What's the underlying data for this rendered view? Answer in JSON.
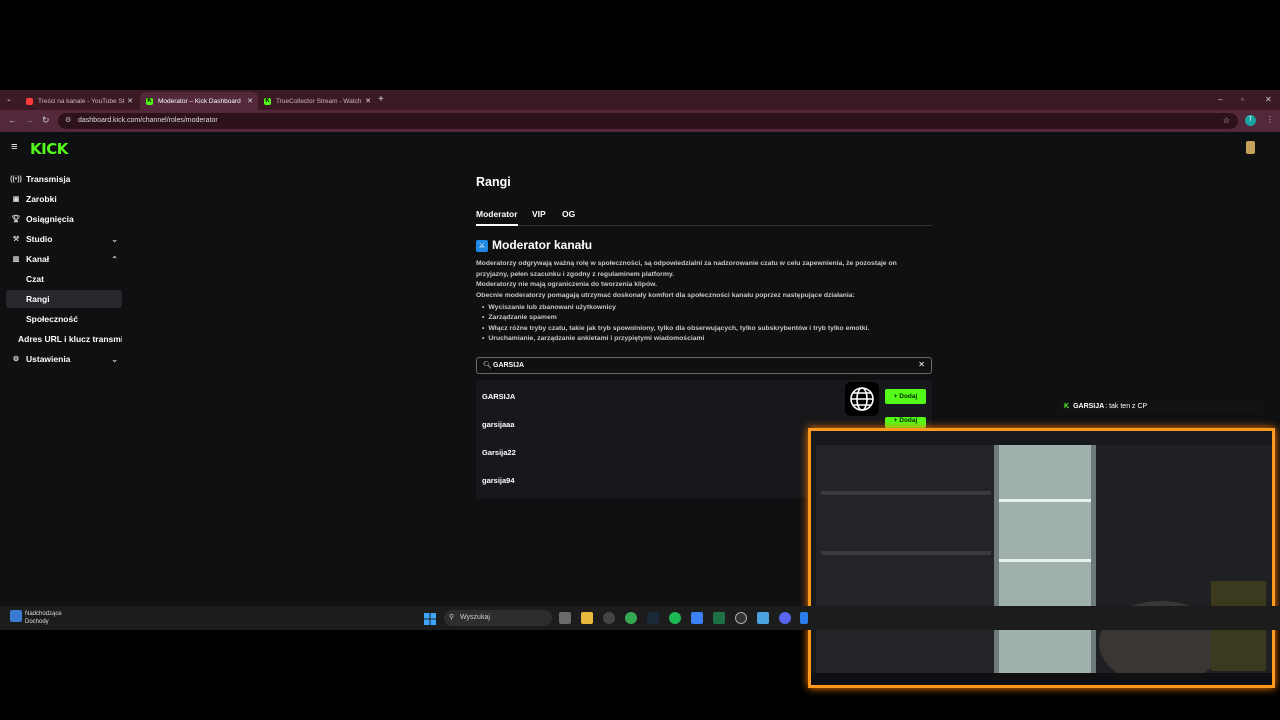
{
  "browser": {
    "tabs": [
      {
        "label": "Treści na kanale - YouTube Studio",
        "active": false,
        "favicon_color": "#ff3b3b"
      },
      {
        "label": "Moderator – Kick Dashboard",
        "active": true,
        "favicon_color": "#53fc18"
      },
      {
        "label": "TrueCollector Stream - Watch Live",
        "active": false,
        "favicon_color": "#53fc18"
      }
    ],
    "url": "dashboard.kick.com/channel/roles/moderator",
    "profile_initial": "T"
  },
  "app": {
    "logo": "KICK",
    "sidebar": {
      "items": [
        {
          "label": "Transmisja",
          "icon": "broadcast-icon"
        },
        {
          "label": "Zarobki",
          "icon": "earnings-icon"
        },
        {
          "label": "Osiągnięcia",
          "icon": "trophy-icon"
        },
        {
          "label": "Studio",
          "icon": "studio-icon"
        },
        {
          "label": "Kanał",
          "icon": "channel-icon"
        }
      ],
      "sub_items": [
        "Czat",
        "Rangi",
        "Społeczność"
      ],
      "extra_items": [
        "Adres URL i klucz transmisji",
        "Ustawienia"
      ]
    },
    "page_title": "Rangi",
    "role_tabs": [
      "Moderator",
      "VIP",
      "OG"
    ],
    "section_title": "Moderator kanału",
    "description": [
      "Moderatorzy odgrywają ważną rolę w społeczności, są odpowiedzialni za nadzorowanie czatu w celu zapewnienia, że pozostaje on",
      "przyjazny, pełen szacunku i zgodny z regulaminem platformy.",
      "Moderatorzy nie mają ograniczenia do tworzenia klipów.",
      "Obecnie moderatorzy pomagają utrzymać doskonały komfort dla społeczności kanału poprzez następujące działania:"
    ],
    "bullets": [
      "Wyciszanie lub zbanowani użytkownicy",
      "Zarządzanie spamem",
      "Włącz różne tryby czatu, takie jak tryb spowolniony, tylko dla obserwujących, tylko subskrybentów i tryb tylko emotki.",
      "Uruchamianie, zarządzanie ankietami i przypiętymi wiadomościami"
    ],
    "search_value": "GARSIJA",
    "results": [
      "GARSIJA",
      "garsijaaa",
      "Garsija22",
      "garsija94"
    ],
    "add_label": "+ Dodaj"
  },
  "overlay": {
    "chat_user": "GARSIJA",
    "chat_text": ": tak ten z CP"
  },
  "taskbar": {
    "weather_line1": "Nadchodzące",
    "weather_line2": "Dochody",
    "search_placeholder": "Wyszukaj"
  }
}
